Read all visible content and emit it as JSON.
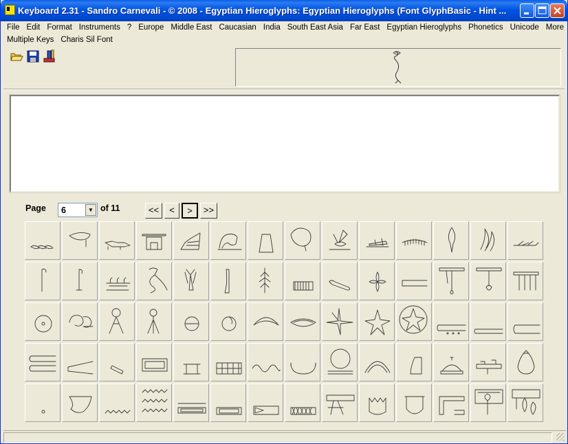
{
  "window": {
    "title": "Keyboard 2.31 - Sandro Carnevali - ©  2008 - Egyptian Hieroglyphs: Egyptian Hieroglyphs (Font GlyphBasic - Hint ..."
  },
  "menu": {
    "row1": [
      "File",
      "Edit",
      "Format",
      "Instruments",
      "?",
      "Europe",
      "Middle East",
      "Caucasian",
      "India",
      "South East Asia",
      "Far East",
      "Egyptian Hieroglyphs",
      "Phonetics",
      "Unicode",
      "More"
    ],
    "row2": [
      "Multiple Keys",
      "Charis Sil Font"
    ]
  },
  "toolbar": {
    "icons": [
      "open-folder-icon",
      "save-disk-icon",
      "unicode-tool-icon"
    ]
  },
  "preview": {
    "glyph_icon": "hieroglyph-fish-preview"
  },
  "pager": {
    "page_label": "Page",
    "current_page": "6",
    "of_label": "of 11",
    "first": "<<",
    "prev": "<",
    "next": ">",
    "last": ">>"
  },
  "glyphs": {
    "rows": 5,
    "cols": 14,
    "names": [
      [
        "loaves",
        "bird-head",
        "crocodile",
        "crocodile-shrine",
        "dorsal-fin",
        "frog",
        "mound",
        "pufferfish",
        "bee",
        "grasshopper",
        "centipede",
        "leaf",
        "flowers",
        "branch"
      ],
      [
        "walking-stick",
        "lily-stem",
        "papyrus-clump",
        "lotus-flower",
        "lily-bundle",
        "knife-blade",
        "tree",
        "reed-bundle",
        "seed-pod",
        "four-petal",
        "cord-rest",
        "hoe-left",
        "hoe-right",
        "comb-sign"
      ],
      [
        "sun-disk",
        "sun-rays",
        "star-tripod",
        "stand",
        "horizon-disk",
        "sphere",
        "arc-sky",
        "crescent-moon",
        "star-flower",
        "star",
        "star-disk",
        "dotted-bar",
        "flat-bar",
        "bar-outline"
      ],
      [
        "double-bar",
        "fire-drill",
        "pestle",
        "rectangle-slab",
        "shrine-table",
        "grid-plot",
        "water-wave",
        "basin",
        "pool-disk",
        "dome-arch",
        "loaf-corner",
        "dome-vessel",
        "press-sign",
        "heart-jar"
      ],
      [
        "dot",
        "horn",
        "zigzag",
        "triple-water",
        "house-slab",
        "rectangle-box",
        "arrow-box",
        "cross-hatch",
        "table-offering",
        "crown-box",
        "jar-u",
        "house-plan",
        "mirror-shrine",
        "scribe-kit"
      ]
    ]
  },
  "colors": {
    "titlebar": "#0054e3",
    "window_bg": "#ece9d8",
    "close_button": "#c44120",
    "glyph_stroke": "#3a3a3a"
  }
}
